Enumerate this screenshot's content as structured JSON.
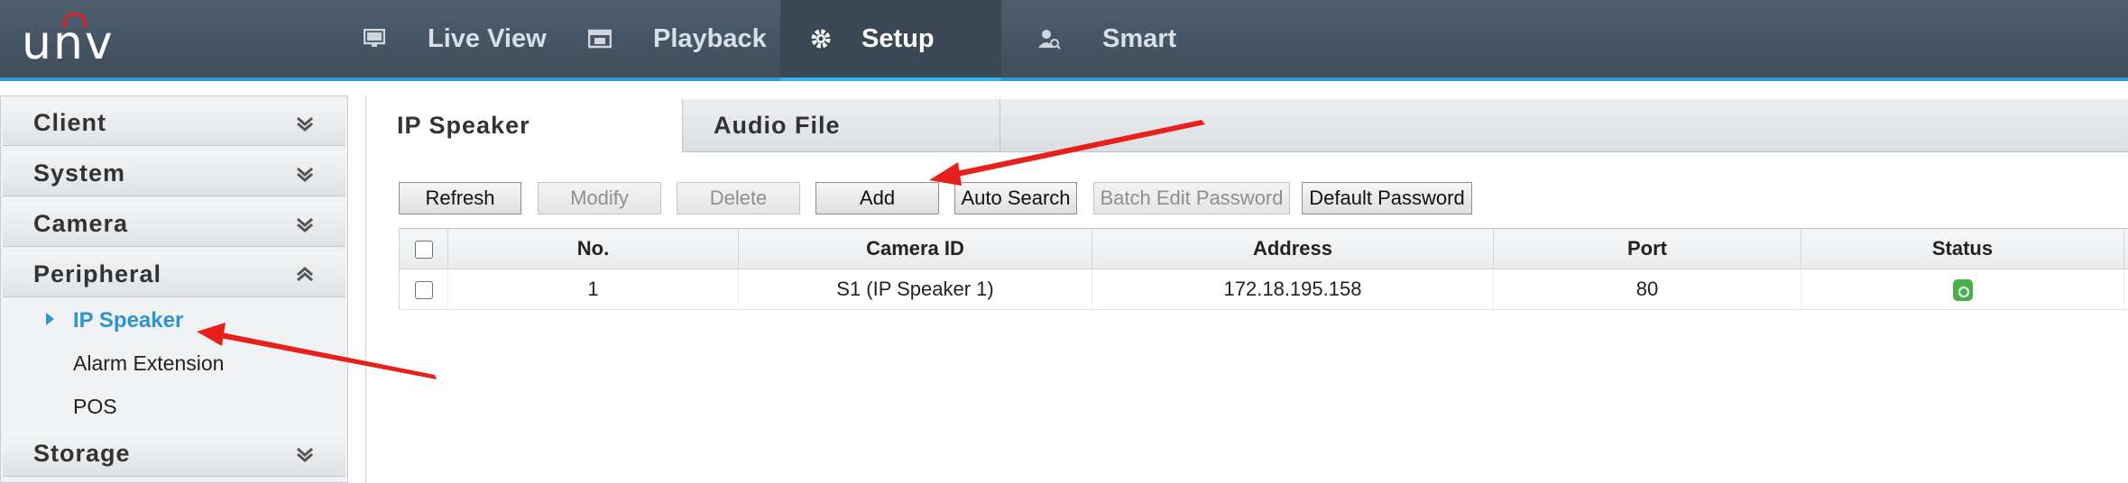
{
  "brand": {
    "logo_text": "unv",
    "accent_color": "#2f9bd3"
  },
  "nav": {
    "items": [
      {
        "label": "Live View",
        "icon": "monitor-icon",
        "active": false
      },
      {
        "label": "Playback",
        "icon": "film-icon",
        "active": false
      },
      {
        "label": "Setup",
        "icon": "gear-icon",
        "active": true
      },
      {
        "label": "Smart",
        "icon": "smart-person-icon",
        "active": false
      }
    ]
  },
  "sidebar": {
    "sections": [
      {
        "label": "Client",
        "expanded": false
      },
      {
        "label": "System",
        "expanded": false
      },
      {
        "label": "Camera",
        "expanded": false
      },
      {
        "label": "Peripheral",
        "expanded": true
      },
      {
        "label": "Storage",
        "expanded": false
      }
    ],
    "peripheral_items": [
      {
        "label": "IP Speaker",
        "active": true
      },
      {
        "label": "Alarm Extension",
        "active": false
      },
      {
        "label": "POS",
        "active": false
      }
    ]
  },
  "tabs": [
    {
      "label": "IP Speaker",
      "active": true
    },
    {
      "label": "Audio File",
      "active": false
    }
  ],
  "toolbar": {
    "refresh": "Refresh",
    "modify": "Modify",
    "delete": "Delete",
    "add": "Add",
    "auto_search": "Auto Search",
    "batch_edit_password": "Batch Edit Password",
    "default_password": "Default Password"
  },
  "table": {
    "columns": [
      "No.",
      "Camera ID",
      "Address",
      "Port",
      "Status"
    ],
    "rows": [
      {
        "no": "1",
        "camera_id": "S1 (IP Speaker 1)",
        "address": "172.18.195.158",
        "port": "80",
        "status": "online",
        "status_color": "#49b14c"
      }
    ]
  },
  "annotations": {
    "arrow_color": "#e8201c"
  }
}
